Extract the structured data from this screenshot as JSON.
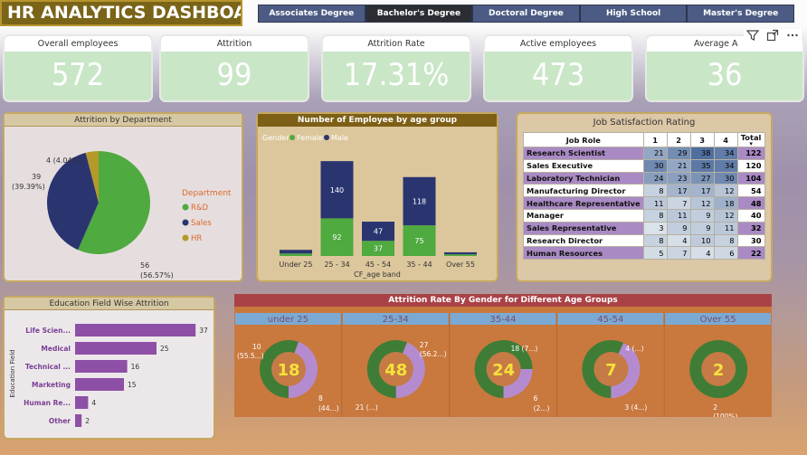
{
  "title": "HR ANALYTICS DASHBOARD",
  "tabs": [
    "Associates Degree",
    "Bachelor's Degree",
    "Doctoral Degree",
    "High School",
    "Master's Degree"
  ],
  "active_tab": 1,
  "kpis": [
    {
      "label": "Overall employees",
      "value": "572"
    },
    {
      "label": "Attrition",
      "value": "99"
    },
    {
      "label": "Attrition Rate",
      "value": "17.31%"
    },
    {
      "label": "Active employees",
      "value": "473"
    },
    {
      "label": "Average A",
      "value": "36"
    }
  ],
  "icons": [
    "filter-icon",
    "focus-mode-icon",
    "more-options-icon"
  ],
  "dept_pie": {
    "title": "Attrition by Department",
    "legend_title": "Department",
    "slices": [
      {
        "name": "R&D",
        "value": 56,
        "label1": "56",
        "label2": "(56.57%)",
        "color": "#4faa3f"
      },
      {
        "name": "Sales",
        "value": 39,
        "label1": "39",
        "label2": "(39.39%)",
        "color": "#2a3570"
      },
      {
        "name": "HR",
        "value": 4,
        "label1": "4 (4.04%)",
        "label2": "",
        "color": "#b59a2a"
      }
    ]
  },
  "age_chart": {
    "title": "Number of Employee by age group",
    "legend_title": "Gender",
    "legend": [
      {
        "name": "Female",
        "color": "#4faa3f"
      },
      {
        "name": "Male",
        "color": "#2a3570"
      }
    ],
    "xlabel": "CF_age band",
    "categories": [
      "Under 25",
      "25 - 34",
      "45 - 54",
      "35 - 44",
      "Over 55"
    ],
    "female": [
      6,
      92,
      37,
      75,
      4
    ],
    "male": [
      9,
      140,
      47,
      118,
      5
    ],
    "female_labels": [
      "",
      "92",
      "37",
      "75",
      ""
    ],
    "male_labels": [
      "",
      "140",
      "47",
      "118",
      ""
    ]
  },
  "job_sat": {
    "title": "Job Satisfaction Rating",
    "headers": [
      "Job Role",
      "1",
      "2",
      "3",
      "4",
      "Total"
    ],
    "rows": [
      {
        "role": "Research Scientist",
        "v": [
          "21",
          "29",
          "38",
          "34"
        ],
        "total": "122"
      },
      {
        "role": "Sales Executive",
        "v": [
          "30",
          "21",
          "35",
          "34"
        ],
        "total": "120"
      },
      {
        "role": "Laboratory Technician",
        "v": [
          "24",
          "23",
          "27",
          "30"
        ],
        "total": "104"
      },
      {
        "role": "Manufacturing Director",
        "v": [
          "8",
          "17",
          "17",
          "12"
        ],
        "total": "54"
      },
      {
        "role": "Healthcare Representative",
        "v": [
          "11",
          "7",
          "12",
          "18"
        ],
        "total": "48"
      },
      {
        "role": "Manager",
        "v": [
          "8",
          "11",
          "9",
          "12"
        ],
        "total": "40"
      },
      {
        "role": "Sales Representative",
        "v": [
          "3",
          "9",
          "9",
          "11"
        ],
        "total": "32"
      },
      {
        "role": "Research Director",
        "v": [
          "8",
          "4",
          "10",
          "8"
        ],
        "total": "30"
      },
      {
        "role": "Human Resources",
        "v": [
          "5",
          "7",
          "4",
          "6"
        ],
        "total": "22"
      }
    ]
  },
  "edu_chart": {
    "title": "Education Field Wise Attrition",
    "ylabel": "Education Field",
    "categories": [
      "Life Scien...",
      "Medical",
      "Technical ...",
      "Marketing",
      "Human Re...",
      "Other"
    ],
    "values": [
      37,
      25,
      16,
      15,
      4,
      2
    ],
    "color": "#8e4fa6"
  },
  "gender_donuts": {
    "title": "Attrition Rate By Gender for Different Age Groups",
    "groups": [
      {
        "label": "under 25",
        "center": "18",
        "green": 10,
        "purple": 8,
        "greenLabel1": "10",
        "greenLabel2": "(55.5...)",
        "purpleLabel1": "8",
        "purpleLabel2": "(44...)"
      },
      {
        "label": "25-34",
        "center": "48",
        "green": 27,
        "purple": 21,
        "greenLabel1": "27",
        "greenLabel2": "(56.2...)",
        "purpleLabel1": "21 (...)",
        "purpleLabel2": ""
      },
      {
        "label": "35-44",
        "center": "24",
        "green": 18,
        "purple": 6,
        "greenLabel1": "18 (7...)",
        "greenLabel2": "",
        "purpleLabel1": "6",
        "purpleLabel2": "(2...)"
      },
      {
        "label": "45-54",
        "center": "7",
        "green": 4,
        "purple": 3,
        "greenLabel1": "4 (...)",
        "greenLabel2": "",
        "purpleLabel1": "3 (4...)",
        "purpleLabel2": ""
      },
      {
        "label": "Over 55",
        "center": "2",
        "green": 2,
        "purple": 0,
        "greenLabel1": "2",
        "greenLabel2": "(100%)",
        "purpleLabel1": "",
        "purpleLabel2": ""
      }
    ]
  },
  "chart_data": [
    {
      "type": "pie",
      "title": "Attrition by Department",
      "categories": [
        "R&D",
        "Sales",
        "HR"
      ],
      "values": [
        56,
        39,
        4
      ]
    },
    {
      "type": "bar",
      "title": "Number of Employee by age group",
      "xlabel": "CF_age band",
      "categories": [
        "Under 25",
        "25 - 34",
        "45 - 54",
        "35 - 44",
        "Over 55"
      ],
      "series": [
        {
          "name": "Female",
          "values": [
            6,
            92,
            37,
            75,
            4
          ]
        },
        {
          "name": "Male",
          "values": [
            9,
            140,
            47,
            118,
            5
          ]
        }
      ]
    },
    {
      "type": "bar",
      "title": "Education Field Wise Attrition",
      "ylabel": "Education Field",
      "categories": [
        "Life Scien...",
        "Medical",
        "Technical ...",
        "Marketing",
        "Human Re...",
        "Other"
      ],
      "values": [
        37,
        25,
        16,
        15,
        4,
        2
      ]
    },
    {
      "type": "table",
      "title": "Job Satisfaction Rating"
    },
    {
      "type": "pie",
      "title": "Attrition Rate By Gender for Different Age Groups",
      "categories": [
        "under 25",
        "25-34",
        "35-44",
        "45-54",
        "Over 55"
      ],
      "series": [
        {
          "values": [
            10,
            27,
            18,
            4,
            2
          ]
        },
        {
          "values": [
            8,
            21,
            6,
            3,
            0
          ]
        }
      ]
    }
  ]
}
